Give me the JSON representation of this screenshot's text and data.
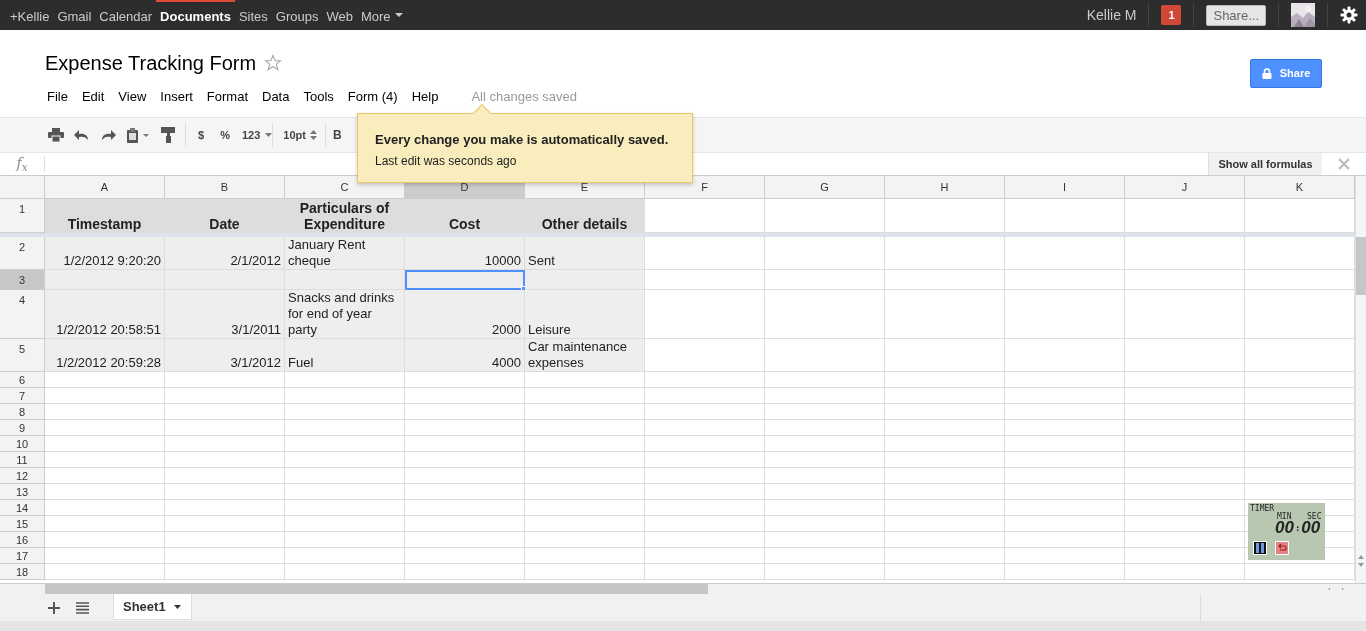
{
  "top_bar": {
    "links": [
      {
        "label": "+Kellie",
        "selected": false
      },
      {
        "label": "Gmail",
        "selected": false
      },
      {
        "label": "Calendar",
        "selected": false
      },
      {
        "label": "Documents",
        "selected": true
      },
      {
        "label": "Sites",
        "selected": false
      },
      {
        "label": "Groups",
        "selected": false
      },
      {
        "label": "Web",
        "selected": false
      },
      {
        "label": "More",
        "selected": false
      }
    ],
    "user": "Kellie M",
    "notifications": "1",
    "share": "Share..."
  },
  "document": {
    "title": "Expense Tracking Form",
    "starred": false,
    "menus": [
      "File",
      "Edit",
      "View",
      "Insert",
      "Format",
      "Data",
      "Tools",
      "Form (4)",
      "Help"
    ],
    "save_status": "All changes saved",
    "share_button": "Share"
  },
  "toolbar": {
    "currency": "$",
    "percent": "%",
    "number_format": "123",
    "font_size": "10pt",
    "bold": "B"
  },
  "tooltip": {
    "heading": "Every change you make is automatically saved.",
    "text": "Last edit was seconds ago"
  },
  "formula_bar": {
    "label": "f$_{x}$",
    "show_formulas": "Show all formulas"
  },
  "sheet": {
    "columns": [
      {
        "label": "A",
        "selected": false
      },
      {
        "label": "B",
        "selected": false
      },
      {
        "label": "C",
        "selected": false
      },
      {
        "label": "D",
        "selected": true
      },
      {
        "label": "E",
        "selected": false
      },
      {
        "label": "F",
        "selected": false
      },
      {
        "label": "G",
        "selected": false
      },
      {
        "label": "H",
        "selected": false
      },
      {
        "label": "I",
        "selected": false
      },
      {
        "label": "J",
        "selected": false
      },
      {
        "label": "K",
        "selected": false
      }
    ],
    "rows": [
      {
        "number": "1",
        "kind": "header",
        "selected": false,
        "frozen": true,
        "cells": [
          {
            "text": "Timestamp",
            "kind": "text"
          },
          {
            "text": "Date",
            "kind": "text"
          },
          {
            "text": "Particulars of Expenditure",
            "kind": "text"
          },
          {
            "text": "Cost",
            "kind": "text"
          },
          {
            "text": "Other details",
            "kind": "text"
          }
        ]
      },
      {
        "number": "2",
        "kind": "data",
        "selected": false,
        "cells": [
          {
            "text": "1/2/2012 9:20:20",
            "kind": "number"
          },
          {
            "text": "2/1/2012",
            "kind": "number"
          },
          {
            "text": "January Rent cheque",
            "kind": "text"
          },
          {
            "text": "10000",
            "kind": "number"
          },
          {
            "text": "Sent",
            "kind": "text"
          }
        ]
      },
      {
        "number": "3",
        "kind": "data",
        "selected": true,
        "cells": [
          null,
          null,
          null,
          null,
          null
        ]
      },
      {
        "number": "4",
        "kind": "data",
        "selected": false,
        "cells": [
          {
            "text": "1/2/2012 20:58:51",
            "kind": "number"
          },
          {
            "text": "3/1/2011",
            "kind": "number"
          },
          {
            "text": "Snacks and drinks for end of year party",
            "kind": "text"
          },
          {
            "text": "2000",
            "kind": "number"
          },
          {
            "text": "Leisure",
            "kind": "text"
          }
        ]
      },
      {
        "number": "5",
        "kind": "data",
        "selected": false,
        "cells": [
          {
            "text": "1/2/2012 20:59:28",
            "kind": "number"
          },
          {
            "text": "3/1/2012",
            "kind": "number"
          },
          {
            "text": "Fuel",
            "kind": "text"
          },
          {
            "text": "4000",
            "kind": "number"
          },
          {
            "text": "Car maintenance expenses",
            "kind": "text"
          }
        ]
      },
      {
        "number": "6",
        "kind": "blank",
        "selected": false
      },
      {
        "number": "7",
        "kind": "blank",
        "selected": false
      },
      {
        "number": "8",
        "kind": "blank",
        "selected": false
      },
      {
        "number": "9",
        "kind": "blank",
        "selected": false
      },
      {
        "number": "10",
        "kind": "blank",
        "selected": false
      },
      {
        "number": "11",
        "kind": "blank",
        "selected": false
      },
      {
        "number": "12",
        "kind": "blank",
        "selected": false
      },
      {
        "number": "13",
        "kind": "blank",
        "selected": false
      },
      {
        "number": "14",
        "kind": "blank",
        "selected": false
      },
      {
        "number": "15",
        "kind": "blank",
        "selected": false
      },
      {
        "number": "16",
        "kind": "blank",
        "selected": false
      },
      {
        "number": "17",
        "kind": "blank",
        "selected": false
      },
      {
        "number": "18",
        "kind": "blank",
        "selected": false
      }
    ],
    "tabs": [
      {
        "label": "Sheet1",
        "selected": true
      }
    ]
  },
  "timer": {
    "title": "TIMER",
    "min_label": "MIN",
    "sec_label": "SEC",
    "minutes": "00",
    "separator": ":",
    "seconds": "00"
  }
}
